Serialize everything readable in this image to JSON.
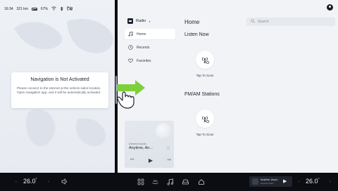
{
  "status_bar": {
    "time": "16:34",
    "range": "321 km",
    "battery": "67%",
    "icons": [
      "battery-icon",
      "wifi-icon",
      "bluetooth-icon",
      "camera-off-icon"
    ]
  },
  "navigation": {
    "card_title": "Navigation is Not Activated",
    "card_body": "Please connect to the internet at the vehicle sales location. Open navigation app, and it will be automatically activated."
  },
  "radio_app": {
    "source_label": "Radio",
    "sidebar": [
      {
        "label": "Home",
        "icon": "music-note-icon",
        "active": true
      },
      {
        "label": "Recents",
        "icon": "clock-icon",
        "active": false
      },
      {
        "label": "Favorites",
        "icon": "heart-icon",
        "active": false
      }
    ],
    "page_title": "Home",
    "search_placeholder": "Search",
    "sections": [
      {
        "title": "Listen Now",
        "tile_label": "Tap To Scan"
      },
      {
        "title": "FM/AM Stations",
        "tile_label": "Tap To Scan"
      }
    ],
    "mini_player": {
      "source": "Desired audio",
      "title": "Anytime, An...",
      "controls": [
        "previous-icon",
        "play-icon",
        "next-icon"
      ]
    }
  },
  "dock": {
    "left_temp": "26.0",
    "right_temp": "26.0",
    "temp_unit": "°",
    "now_playing_title": "Anytime, Anyw...",
    "now_playing_sub": "Desired audio",
    "center_icons": [
      "apps-grid-icon",
      "camera-360-icon",
      "music-icon",
      "car-icon",
      "home-icon"
    ],
    "colors": {
      "accent_green": "#7fcf3a",
      "dock_bg": "#0b0d12",
      "panel_bg": "#f1f3f6"
    }
  }
}
